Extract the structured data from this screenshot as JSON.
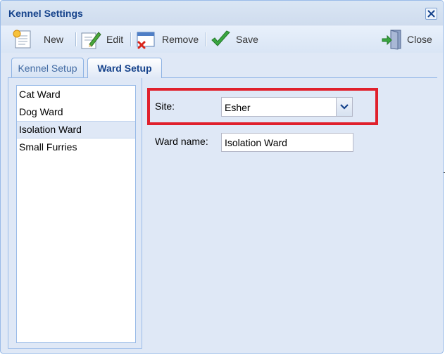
{
  "window": {
    "title": "Kennel Settings"
  },
  "toolbar": {
    "new_label": "New",
    "edit_label": "Edit",
    "remove_label": "Remove",
    "save_label": "Save",
    "close_label": "Close"
  },
  "tabs": [
    {
      "label": "Kennel Setup",
      "active": false
    },
    {
      "label": "Ward Setup",
      "active": true
    }
  ],
  "wards": {
    "items": [
      "Cat Ward",
      "Dog Ward",
      "Isolation Ward",
      "Small Furries"
    ],
    "selected": "Isolation Ward"
  },
  "form": {
    "site_label": "Site:",
    "site_value": "Esher",
    "ward_name_label": "Ward name:",
    "ward_name_value": "Isolation Ward"
  },
  "colors": {
    "highlight": "#e0202c",
    "title_text": "#15428b",
    "panel_bg": "#dfe8f6"
  }
}
